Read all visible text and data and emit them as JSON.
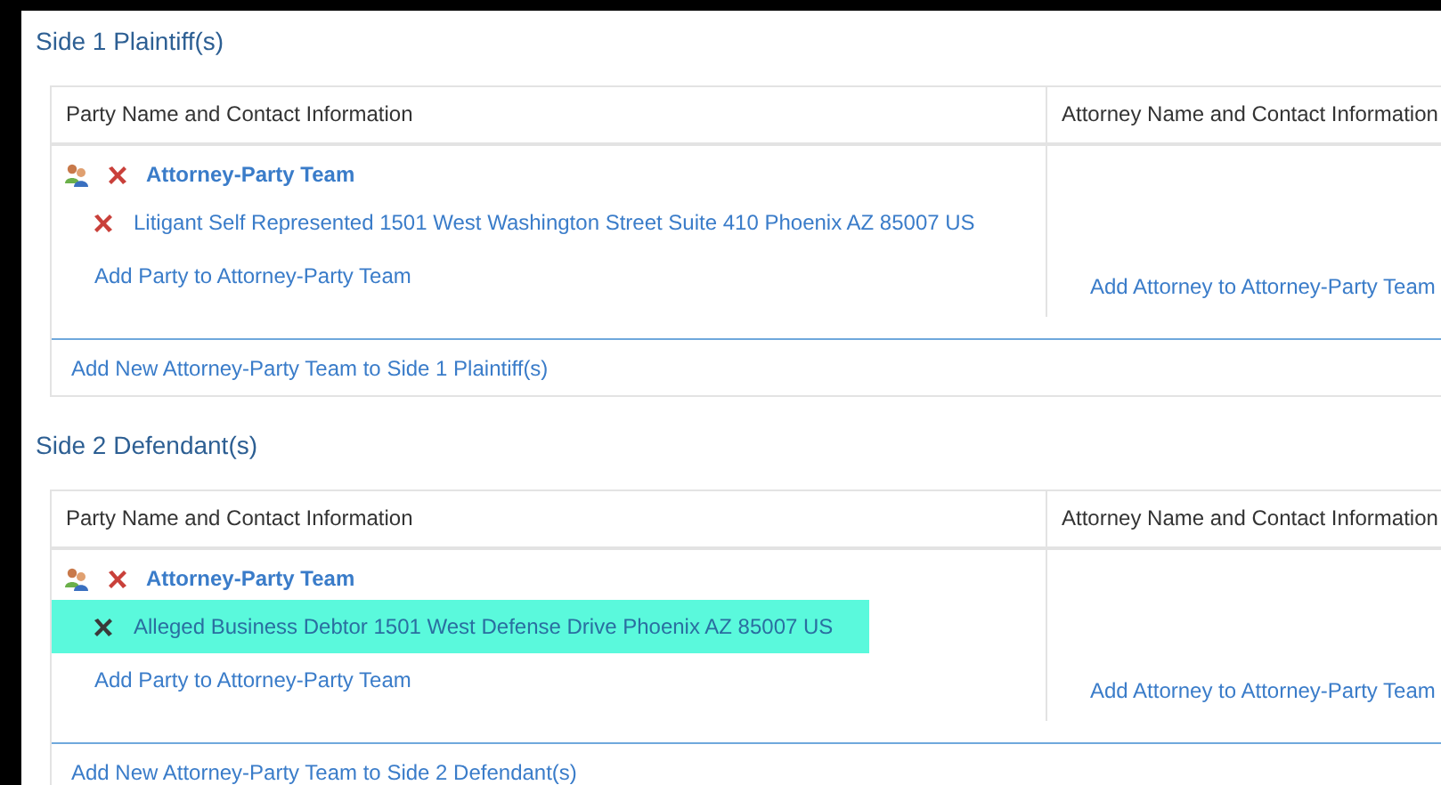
{
  "sides": [
    {
      "title": "Side 1 Plaintiff(s)",
      "columns": [
        "Party Name and Contact Information",
        "Attorney Name and Contact Information"
      ],
      "teams": [
        {
          "label": "Attorney-Party Team",
          "parties": [
            {
              "text": "Litigant Self Represented 1501 West Washington Street Suite 410 Phoenix AZ 85007 US",
              "selected": false
            }
          ],
          "add_party": "Add Party to Attorney-Party Team",
          "add_attorney": "Add Attorney to Attorney-Party Team"
        }
      ],
      "add_team": "Add New Attorney-Party Team to Side 1 Plaintiff(s)"
    },
    {
      "title": "Side 2 Defendant(s)",
      "columns": [
        "Party Name and Contact Information",
        "Attorney Name and Contact Information"
      ],
      "teams": [
        {
          "label": "Attorney-Party Team",
          "parties": [
            {
              "text": "Alleged Business Debtor 1501 West Defense Drive Phoenix AZ 85007 US",
              "selected": true
            }
          ],
          "add_party": "Add Party to Attorney-Party Team",
          "add_attorney": "Add Attorney to Attorney-Party Team"
        }
      ],
      "add_team": "Add New Attorney-Party Team to Side 2 Defendant(s)"
    }
  ]
}
